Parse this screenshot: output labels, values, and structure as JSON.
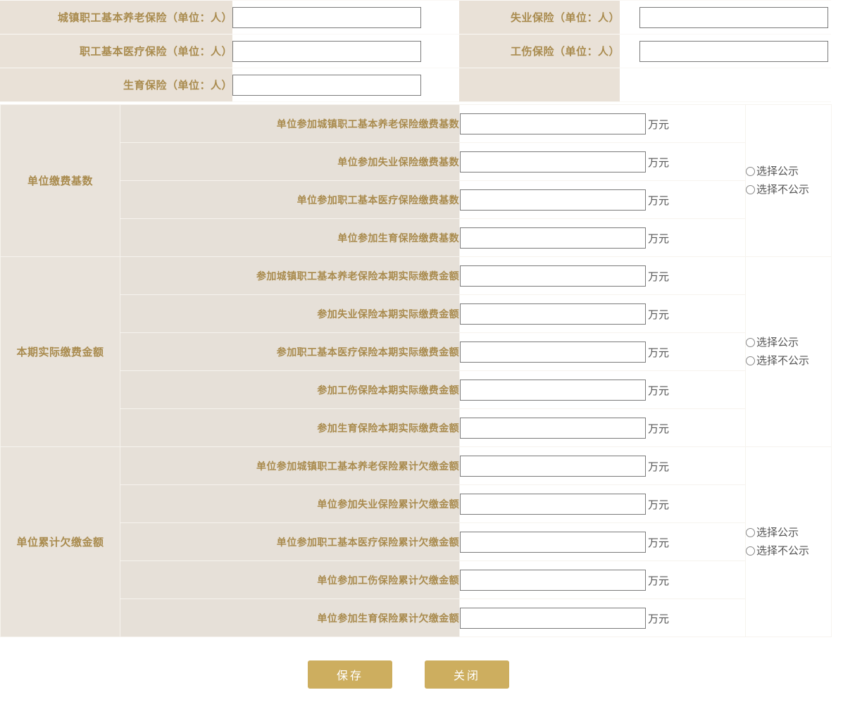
{
  "top_section": {
    "rows": [
      {
        "left_label": "城镇职工基本养老保险（单位：人）",
        "left_value": "",
        "right_label": "失业保险（单位：人）",
        "right_value": "",
        "right_has_input": true
      },
      {
        "left_label": "职工基本医疗保险（单位：人）",
        "left_value": "",
        "right_label": "工伤保险（单位：人）",
        "right_value": "",
        "right_has_input": true
      },
      {
        "left_label": "生育保险（单位：人）",
        "left_value": "",
        "right_label": "",
        "right_value": "",
        "right_has_input": false
      }
    ]
  },
  "main_section": {
    "unit": "万元",
    "publicity": {
      "show_label": "选择公示",
      "hide_label": "选择不公示"
    },
    "groups": [
      {
        "group_label": "单位缴费基数",
        "items": [
          {
            "label": "单位参加城镇职工基本养老保险缴费基数",
            "value": ""
          },
          {
            "label": "单位参加失业保险缴费基数",
            "value": ""
          },
          {
            "label": "单位参加职工基本医疗保险缴费基数",
            "value": ""
          },
          {
            "label": "单位参加生育保险缴费基数",
            "value": ""
          }
        ]
      },
      {
        "group_label": "本期实际缴费金额",
        "items": [
          {
            "label": "参加城镇职工基本养老保险本期实际缴费金额",
            "value": ""
          },
          {
            "label": "参加失业保险本期实际缴费金额",
            "value": ""
          },
          {
            "label": "参加职工基本医疗保险本期实际缴费金额",
            "value": ""
          },
          {
            "label": "参加工伤保险本期实际缴费金额",
            "value": ""
          },
          {
            "label": "参加生育保险本期实际缴费金额",
            "value": ""
          }
        ]
      },
      {
        "group_label": "单位累计欠缴金额",
        "items": [
          {
            "label": "单位参加城镇职工基本养老保险累计欠缴金额",
            "value": ""
          },
          {
            "label": "单位参加失业保险累计欠缴金额",
            "value": ""
          },
          {
            "label": "单位参加职工基本医疗保险累计欠缴金额",
            "value": ""
          },
          {
            "label": "单位参加工伤保险累计欠缴金额",
            "value": ""
          },
          {
            "label": "单位参加生育保险累计欠缴金额",
            "value": ""
          }
        ]
      }
    ]
  },
  "footer": {
    "save_label": "保存",
    "close_label": "关闭"
  },
  "colors": {
    "label_gold": "#a98b4e",
    "label_bg": "#e9e1d7",
    "item_bg": "#e6e0d8",
    "group_bg": "#e9e3db",
    "button_gold": "#cdae5f",
    "input_border": "#7a7a7a"
  }
}
